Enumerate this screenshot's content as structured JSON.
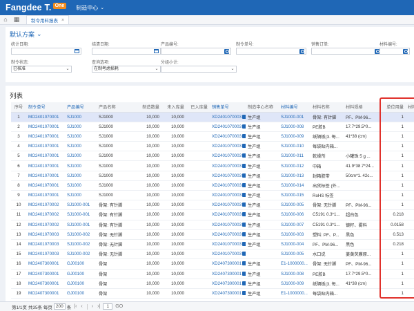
{
  "app": {
    "logo": "Fangdee T.",
    "logo_badge": "One",
    "module": "制造中心"
  },
  "tabbar": {
    "active_tab": "制令用料报表"
  },
  "scheme": {
    "label": "默认方案"
  },
  "filters": [
    {
      "label": "统计日期:",
      "value": "",
      "icon": "calendar-icon"
    },
    {
      "label": "结清日期:",
      "value": "",
      "icon": "calendar-icon"
    },
    {
      "label": "产品编号:",
      "value": "",
      "icon": "search-icon"
    },
    {
      "label": "制令单号:",
      "value": "",
      "icon": "search-icon"
    },
    {
      "label": "销售订单:",
      "value": "",
      "icon": "search-icon"
    },
    {
      "label": "材料编号:",
      "value": "",
      "icon": "search-icon"
    },
    {
      "label": "制令状态:",
      "value": "已核准",
      "icon": "chevron-down-icon"
    },
    {
      "label": "查询选项:",
      "value": "在制考虑损耗",
      "icon": "chevron-down-icon"
    },
    {
      "label": "分组小计:",
      "value": "",
      "icon": "chevron-down-icon"
    }
  ],
  "list": {
    "title": "列表",
    "columns": [
      "序号",
      "制令单号",
      "产品编号",
      "产品名称",
      "制造数量",
      "未入库量",
      "已入库量",
      "销售单号",
      "制造中心名称",
      "材料编号",
      "材料名称",
      "材料规格",
      "单位用量",
      "材料"
    ],
    "rows": [
      [
        "1",
        "MO2401070001",
        "SJ1000",
        "SJ1000",
        "10,000",
        "10,000",
        "",
        "XD2401070003",
        "生产组",
        "SJ1000-001",
        "骨架: 有针脚",
        "PF、PM-96...",
        "1",
        ""
      ],
      [
        "2",
        "MO2401070001",
        "SJ1000",
        "SJ1000",
        "10,000",
        "10,000",
        "",
        "XD2401070003",
        "生产组",
        "SJ1000-008",
        "PE胶B",
        "17.7*29.5*0...",
        "1",
        ""
      ],
      [
        "3",
        "MO2401070001",
        "SJ1000",
        "SJ1000",
        "10,000",
        "10,000",
        "",
        "XD2401070003",
        "生产组",
        "SJ1000-009",
        "纸隔板(3. 每...",
        "41*38 (cm)",
        "1",
        ""
      ],
      [
        "4",
        "MO2401070001",
        "SJ1000",
        "SJ1000",
        "10,000",
        "10,000",
        "",
        "XD2401070003",
        "生产组",
        "SJ1000-010",
        "每袋贴内箱...",
        "",
        "1",
        ""
      ],
      [
        "5",
        "MO2401070001",
        "SJ1000",
        "SJ1000",
        "10,000",
        "10,000",
        "",
        "XD2401070003",
        "生产组",
        "SJ1000-011",
        "乾燥剂",
        "小罐珠 5 g ...",
        "1",
        ""
      ],
      [
        "6",
        "MO2401070001",
        "SJ1000",
        "SJ1000",
        "10,000",
        "10,000",
        "",
        "XD2401070003",
        "生产组",
        "SJ1000-012",
        "中箱",
        "41.9*38.7*24...",
        "1",
        ""
      ],
      [
        "7",
        "MO2401070001",
        "SJ1000",
        "SJ1000",
        "10,000",
        "10,000",
        "",
        "XD2401070003",
        "生产组",
        "SJ1000-013",
        "封箱胶带",
        "50cm*1. 42c...",
        "1",
        ""
      ],
      [
        "8",
        "MO2401070001",
        "SJ1000",
        "SJ1000",
        "10,000",
        "10,000",
        "",
        "XD2401070003",
        "生产组",
        "SJ1000-014",
        "出货标签 (外...",
        "",
        "1",
        ""
      ],
      [
        "9",
        "MO2401070001",
        "SJ1000",
        "SJ1000",
        "10,000",
        "10,000",
        "",
        "XD2401070003",
        "生产组",
        "SJ1000-015",
        "RoHS 标签",
        "",
        "1",
        ""
      ],
      [
        "10",
        "MO2401070002",
        "SJ1000-001",
        "骨架: 有针脚",
        "10,000",
        "10,000",
        "",
        "XD2401070003",
        "生产组",
        "SJ1000-005",
        "骨架: 无针脚",
        "PF、PM-96...",
        "1",
        ""
      ],
      [
        "11",
        "MO2401070002",
        "SJ1000-001",
        "骨架: 有针脚",
        "10,000",
        "10,000",
        "",
        "XD2401070003",
        "生产组",
        "SJ1000-006",
        "C5191 0.3*1...",
        "超白色",
        "0.218",
        ""
      ],
      [
        "12",
        "MO2401070002",
        "SJ1000-001",
        "骨架: 有针脚",
        "10,000",
        "10,000",
        "",
        "XD2401070003",
        "生产组",
        "SJ1000-007",
        "C5191 0.3*1...",
        "镀籽、雾料",
        "0.0158",
        ""
      ],
      [
        "13",
        "MO2401070003",
        "SJ1000-002",
        "骨架: 无针脚",
        "10,000",
        "10,000",
        "",
        "XD2401070003",
        "生产组",
        "SJ1000-003",
        "塑料: PF、P...",
        "黑色",
        "0.513",
        ""
      ],
      [
        "14",
        "MO2401070003",
        "SJ1000-002",
        "骨架: 无针脚",
        "10,000",
        "10,000",
        "",
        "XD2401070003",
        "生产组",
        "SJ1000-004",
        "PF、PM-96...",
        "黑色",
        "0.218",
        ""
      ],
      [
        "15",
        "MO2401070003",
        "SJ1000-002",
        "骨架: 无针脚",
        "10,000",
        "10,000",
        "",
        "XD2401070003",
        "",
        "SJ1000-005",
        "水口说",
        "菱黄荧膜原...",
        "1",
        ""
      ],
      [
        "16",
        "MO2407300001",
        "GJ00100",
        "骨架",
        "10,000",
        "10,000",
        "",
        "XD2407300001",
        "生产组",
        "E1-1000000...",
        "骨架: 无针脚",
        "PF、PM-96...",
        "1",
        ""
      ],
      [
        "17",
        "MO2407300001",
        "GJ00100",
        "骨架",
        "10,000",
        "10,000",
        "",
        "XD2407300001",
        "生产组",
        "SJ1000-008",
        "PE胶B",
        "17.7*29.5*0...",
        "1",
        ""
      ],
      [
        "18",
        "MO2407300001",
        "GJ00100",
        "骨架",
        "10,000",
        "10,000",
        "",
        "XD2407300001",
        "生产组",
        "SJ1000-009",
        "纸隔板(3. 每...",
        "41*38 (cm)",
        "1",
        ""
      ],
      [
        "19",
        "MO2407300001",
        "GJ00100",
        "骨架",
        "10,000",
        "10,000",
        "",
        "XD2407300001",
        "生产组",
        "E1-1000000...",
        "每袋贴内箱...",
        "",
        "1",
        ""
      ]
    ]
  },
  "pager": {
    "info_prefix": "第1/1页 共35条 每页",
    "page_size": "200",
    "info_suffix": "条",
    "page_input": "1",
    "go_label": "GO"
  },
  "colors": {
    "brand_blue": "#1f67b6",
    "badge_orange": "#f28c1e",
    "highlight_red": "#e0312b",
    "selected_row": "#dfe6f8"
  }
}
